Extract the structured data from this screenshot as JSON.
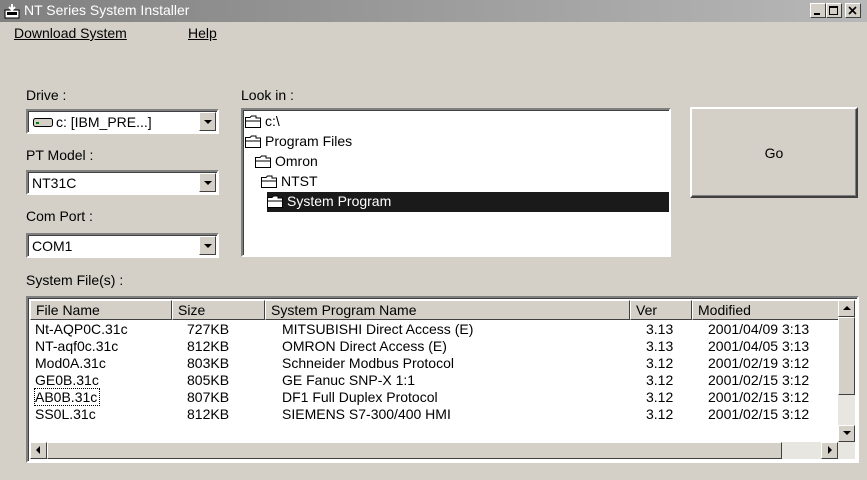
{
  "window": {
    "title": "NT Series System Installer"
  },
  "menu": {
    "download_system": "Download System",
    "help": "Help"
  },
  "drive": {
    "label": "Drive :",
    "value": "c: [IBM_PRE...]"
  },
  "pt_model": {
    "label": "PT Model :",
    "value": "NT31C"
  },
  "com_port": {
    "label": "Com Port :",
    "value": "COM1"
  },
  "look_in": {
    "label": "Look in :",
    "items": [
      "c:\\",
      "Program Files",
      "Omron",
      "NTST",
      "System Program"
    ],
    "selected_index": 4
  },
  "go_button": {
    "label": "Go"
  },
  "files": {
    "label": "System File(s) :",
    "columns": [
      "File Name",
      "Size",
      "System Program Name",
      "Ver",
      "Modified"
    ],
    "rows": [
      [
        "Nt-AQP0C.31c",
        "727KB",
        "MITSUBISHI Direct Access (E)",
        "3.13",
        "2001/04/09 3:13"
      ],
      [
        "NT-aqf0c.31c",
        "812KB",
        "OMRON Direct Access (E)",
        "3.13",
        "2001/04/05 3:13"
      ],
      [
        "Mod0A.31c",
        "803KB",
        "Schneider Modbus Protocol",
        "3.12",
        "2001/02/19 3:12"
      ],
      [
        "GE0B.31c",
        "805KB",
        "GE Fanuc SNP-X 1:1",
        "3.12",
        "2001/02/15 3:12"
      ],
      [
        "AB0B.31c",
        "807KB",
        "DF1 Full Duplex Protocol",
        "3.12",
        "2001/02/15 3:12"
      ],
      [
        "SS0L.31c",
        "812KB",
        "SIEMENS S7-300/400 HMI",
        "3.12",
        "2001/02/15 3:12"
      ]
    ],
    "focused_index": 4
  },
  "colors": {
    "titlebar": "#808080",
    "selection": "#1a1a1a",
    "face": "#d4d0c8"
  }
}
